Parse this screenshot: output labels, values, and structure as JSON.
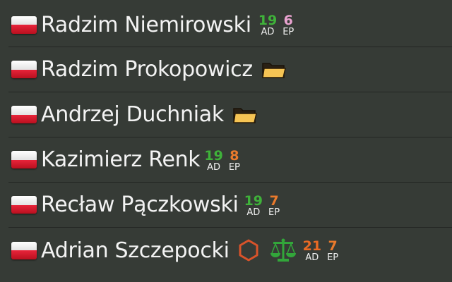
{
  "colors": {
    "background": "#363b36",
    "ad_green": "#3fb23a",
    "ep_pink": "#e9a3d0",
    "ep_orange": "#ea7a2c",
    "ad_orange": "#ea6a24",
    "folder_yellow": "#f6c454",
    "hex_orange": "#d9532a",
    "scales_green": "#32a63a"
  },
  "players": [
    {
      "flag_icon": "poland-flag-icon",
      "name": "Radzim Niemirowski",
      "stats": [
        {
          "value": "19",
          "label": "AD",
          "color": "#3fb23a"
        },
        {
          "value": "6",
          "label": "EP",
          "color": "#e9a3d0"
        }
      ]
    },
    {
      "flag_icon": "poland-flag-icon",
      "name": "Radzim Prokopowicz",
      "icons": [
        "folder-icon"
      ]
    },
    {
      "flag_icon": "poland-flag-icon",
      "name": "Andrzej Duchniak",
      "icons": [
        "folder-icon"
      ]
    },
    {
      "flag_icon": "poland-flag-icon",
      "name": "Kazimierz Renk",
      "stats": [
        {
          "value": "19",
          "label": "AD",
          "color": "#3fb23a"
        },
        {
          "value": "8",
          "label": "EP",
          "color": "#ea7a2c"
        }
      ]
    },
    {
      "flag_icon": "poland-flag-icon",
      "name": "Recław Pączkowski",
      "stats": [
        {
          "value": "19",
          "label": "AD",
          "color": "#3fb23a"
        },
        {
          "value": "7",
          "label": "EP",
          "color": "#ea7a2c"
        }
      ]
    },
    {
      "flag_icon": "poland-flag-icon",
      "name": "Adrian Szczepocki",
      "icons": [
        "hexagon-icon",
        "scales-icon"
      ],
      "stats": [
        {
          "value": "21",
          "label": "AD",
          "color": "#ea6a24"
        },
        {
          "value": "7",
          "label": "EP",
          "color": "#ea7a2c"
        }
      ]
    }
  ]
}
